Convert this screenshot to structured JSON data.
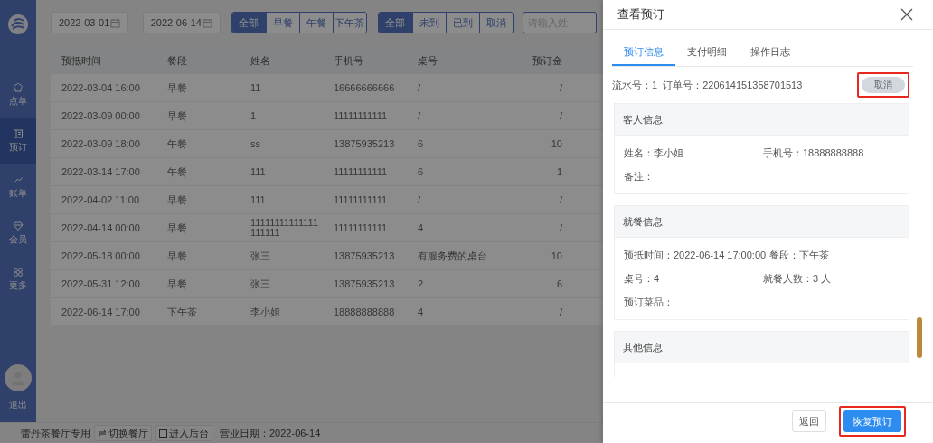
{
  "sidebar": {
    "items": [
      {
        "label": "点单",
        "selected": false
      },
      {
        "label": "预订",
        "selected": true
      },
      {
        "label": "账单",
        "selected": false
      },
      {
        "label": "会员",
        "selected": false
      },
      {
        "label": "更多",
        "selected": false
      }
    ],
    "logout": "退出"
  },
  "filters": {
    "date_from": "2022-03-01",
    "date_separator": "-",
    "date_to": "2022-06-14",
    "meal_buttons": [
      {
        "label": "全部",
        "selected": true
      },
      {
        "label": "早餐",
        "selected": false
      },
      {
        "label": "午餐",
        "selected": false
      },
      {
        "label": "下午茶",
        "selected": false
      }
    ],
    "status_buttons": [
      {
        "label": "全部",
        "selected": true
      },
      {
        "label": "未到",
        "selected": false
      },
      {
        "label": "已到",
        "selected": false
      },
      {
        "label": "取消",
        "selected": false
      }
    ],
    "search": {
      "placeholder": "请输入姓"
    }
  },
  "table": {
    "columns": [
      "预抵时间",
      "餐段",
      "姓名",
      "手机号",
      "桌号",
      "预订金"
    ],
    "rows": [
      [
        "2022-03-04 16:00",
        "早餐",
        "11",
        "16666666666",
        "/",
        "/"
      ],
      [
        "2022-03-09 00:00",
        "早餐",
        "1",
        "11111111111",
        "/",
        "/"
      ],
      [
        "2022-03-09 18:00",
        "午餐",
        "ss",
        "13875935213",
        "6",
        "10"
      ],
      [
        "2022-03-14 17:00",
        "午餐",
        "111",
        "11111111111",
        "6",
        "1"
      ],
      [
        "2022-04-02 11:00",
        "早餐",
        "111",
        "11111111111",
        "/",
        "/"
      ],
      [
        "2022-04-14 00:00",
        "早餐",
        "11111111111111111111",
        "11111111111",
        "4",
        "/"
      ],
      [
        "2022-05-18 00:00",
        "早餐",
        "张三",
        "13875935213",
        "有服务费的桌台",
        "10"
      ],
      [
        "2022-05-31 12:00",
        "早餐",
        "张三",
        "13875935213",
        "2",
        "6"
      ],
      [
        "2022-06-14 17:00",
        "下午茶",
        "李小姐",
        "18888888888",
        "4",
        "/"
      ]
    ]
  },
  "status_bar": {
    "shop": "蕾丹茶餐厅专用",
    "switch_button": "切换餐厅",
    "backend_button": "进入后台",
    "business_date": "营业日期：2022-06-14"
  },
  "drawer": {
    "title": "查看预订",
    "tabs": [
      {
        "label": "预订信息",
        "selected": true
      },
      {
        "label": "支付明细",
        "selected": false
      },
      {
        "label": "操作日志",
        "selected": false
      }
    ],
    "serial": "流水号：1  订单号：220614151358701513",
    "cancel_button": {
      "label": "取消",
      "disabled": true,
      "highlighted": true
    },
    "sections": [
      {
        "title": "客人信息",
        "rows": [
          {
            "kind": "columns",
            "items": [
              "姓名：李小姐",
              "手机号：18888888888"
            ]
          },
          {
            "kind": "columns",
            "items": [
              "备注："
            ]
          }
        ]
      },
      {
        "title": "就餐信息",
        "rows": [
          {
            "kind": "inline",
            "items": [
              "预抵时间：2022-06-14 17:00:00",
              "餐段：下午茶"
            ]
          },
          {
            "kind": "columns",
            "items": [
              "桌号：4",
              "就餐人数：3 人"
            ]
          },
          {
            "kind": "columns",
            "items": [
              "预订菜品："
            ]
          }
        ]
      },
      {
        "title": "其他信息"
      }
    ],
    "back_button": {
      "label": "返回"
    },
    "restore_button": {
      "label": "恢复预订",
      "highlighted": true
    }
  }
}
